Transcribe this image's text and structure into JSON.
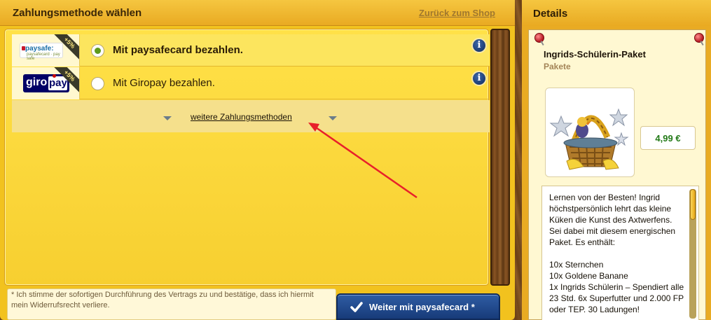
{
  "left": {
    "title": "Zahlungsmethode wählen",
    "back_link": "Zurück zum Shop"
  },
  "methods": [
    {
      "label": "Mit paysafecard bezahlen.",
      "selected": true,
      "bonus": "+5%",
      "logo": {
        "main": "paysafe:",
        "sub": "paysafecard · pay safe"
      },
      "icon": "paysafecard-logo"
    },
    {
      "label": "Mit Giropay bezahlen.",
      "selected": false,
      "bonus": "+5%",
      "logo": {
        "left": "giro",
        "right": "pay"
      },
      "icon": "giropay-logo"
    }
  ],
  "more_methods": "weitere Zahlungsmethoden",
  "terms": "* Ich stimme der sofortigen Durchführung des Vertrags zu und bestätige, dass ich hiermit mein Widerrufsrecht verliere.",
  "continue_button": "Weiter mit paysafecard *",
  "details": {
    "title": "Details",
    "product_name": "Ingrids-Schülerin-Paket",
    "category": "Pakete",
    "price": "4,99 €",
    "description_intro": "Lernen von der Besten! Ingrid höchstpersönlich lehrt das kleine Küken die Kunst des Axtwerfens. Sei dabei mit diesem energischen Paket. Es enthält:",
    "items": [
      "10x Sternchen",
      "10x Goldene Banane",
      "1x Ingrids Schülerin – Spendiert alle 23 Std. 6x Superfutter und 2.000 FP oder TEP. 30 Ladungen!"
    ]
  },
  "colors": {
    "panel_yellow": "#f2c21e",
    "selected_row": "#fce55e",
    "button_blue": "#1f4b91",
    "price_green": "#237a18",
    "annotation_arrow": "#e8202a"
  }
}
